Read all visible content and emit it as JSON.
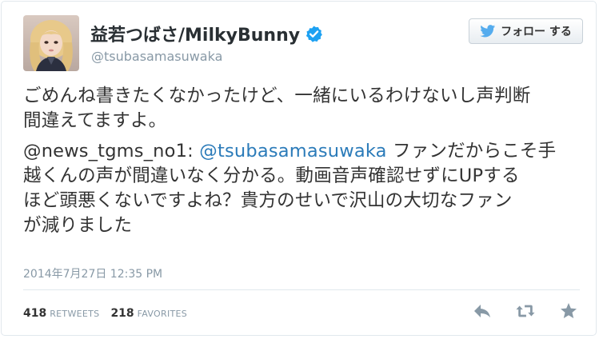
{
  "user": {
    "display_name": "益若つばさ/MilkyBunny",
    "screen_name": "@tsubasamasuwaka",
    "verified": true,
    "avatar_icon": "user-avatar"
  },
  "follow_button": {
    "label": "フォロー する",
    "icon": "twitter-bird-icon"
  },
  "tweet": {
    "line1": "ごめんね書きたくなかったけど、一緒にいるわけないし声判断",
    "line2": "間違えてますよ。",
    "mention_prefix": "@news_tgms_no1: ",
    "mention_link": "@tsubasamasuwaka",
    "quote_line1_rest": " ファンだからこそ手",
    "quote_line2": "越くんの声が間違いなく分かる。動画音声確認せずにUPする",
    "quote_line3": "ほど頭悪くないですよね？貴方のせいで沢山の大切なファン",
    "quote_line4": "が減りました"
  },
  "timestamp": "2014年7月27日  12:35 PM",
  "stats": {
    "retweets_count": "418",
    "retweets_label": "RETWEETS",
    "favorites_count": "218",
    "favorites_label": "FAVORITES"
  },
  "actions": [
    "reply-icon",
    "retweet-icon",
    "favorite-icon"
  ],
  "colors": {
    "link": "#2b7bb9",
    "verified_badge": "#1da1f2",
    "muted": "#8899a6",
    "bird": "#55acee"
  }
}
